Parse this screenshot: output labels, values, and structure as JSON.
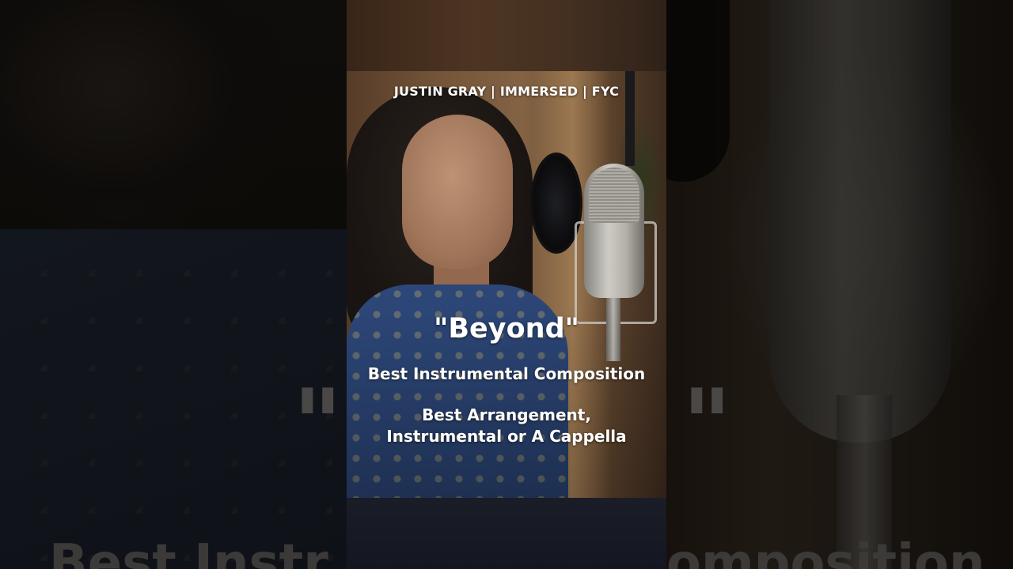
{
  "video": {
    "header": "JUSTIN GRAY | IMMERSED | FYC",
    "title": "\"Beyond\"",
    "award_1": "Best Instrumental Composition",
    "award_2_line_1": "Best Arrangement,",
    "award_2_line_2": "Instrumental or A Cappella"
  },
  "background": {
    "ghost_quote_left": "\"",
    "ghost_quote_right": "\"",
    "ghost_text_left": "Best Instr",
    "ghost_text_right": "omposition"
  }
}
